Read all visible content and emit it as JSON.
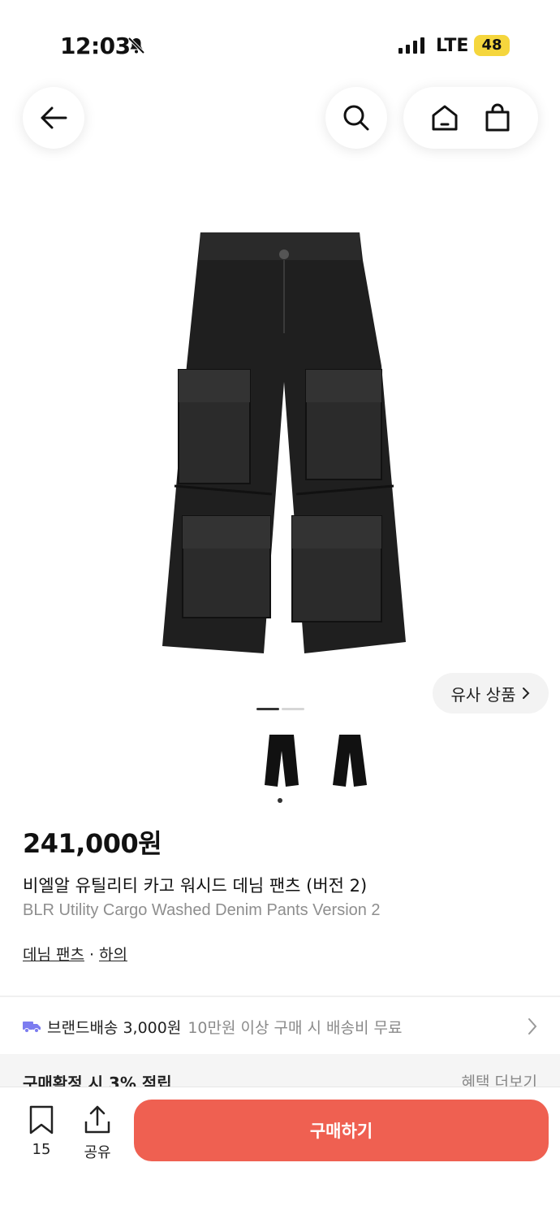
{
  "status_bar": {
    "time": "12:03",
    "network": "LTE",
    "battery": "48",
    "battery_color": "#f5d63d"
  },
  "nav": {
    "back_icon": "arrow-left-icon",
    "search_icon": "search-icon",
    "home_icon": "home-icon",
    "cart_icon": "shopping-bag-icon"
  },
  "product": {
    "similar_label": "유사 상품",
    "price": "241,000원",
    "name_ko": "비엘알 유틸리티 카고 워시드 데님 팬츠 (버전 2)",
    "name_en": "BLR Utility Cargo Washed Denim Pants Version 2",
    "category": [
      "데님 팬츠",
      "하의"
    ],
    "category_sep": "·"
  },
  "shipping": {
    "brand_label": "브랜드배송 3,000원",
    "condition": "10만원 이상 구매 시 배송비 무료",
    "accent_color": "#7c7cf0"
  },
  "benefit": {
    "label": "구매확정 시 3% 적립",
    "more_label": "혜택 더보기"
  },
  "bottom_bar": {
    "bookmark_count": "15",
    "share_label": "공유",
    "buy_label": "구매하기",
    "buy_color": "#ef6051"
  }
}
